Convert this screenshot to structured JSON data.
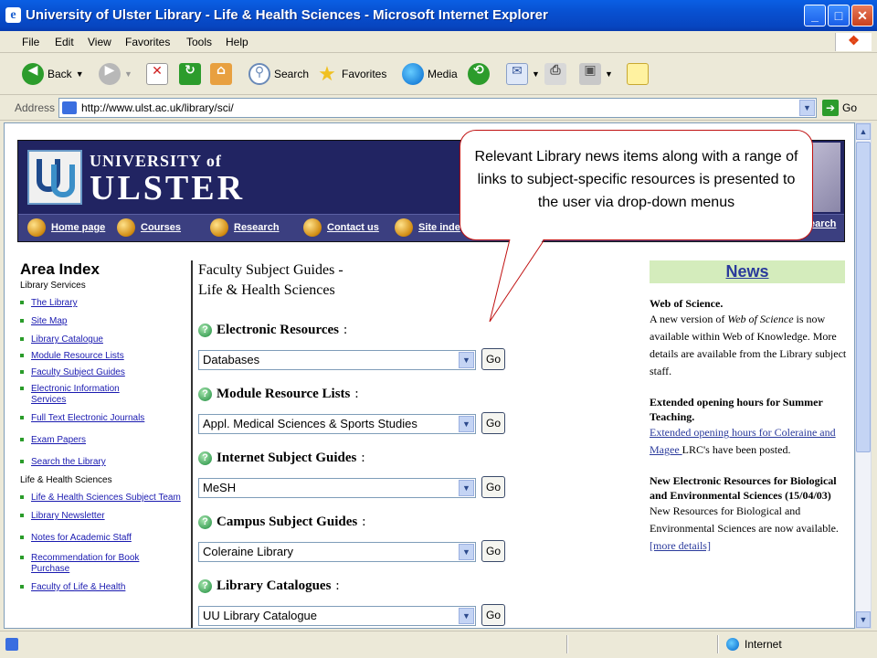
{
  "window": {
    "title": "University of Ulster Library - Life & Health Sciences - Microsoft Internet Explorer",
    "controls": {
      "minimize": "_",
      "maximize": "□",
      "close": "✕"
    }
  },
  "menu": [
    "File",
    "Edit",
    "View",
    "Favorites",
    "Tools",
    "Help"
  ],
  "toolbar": {
    "back": "Back",
    "search": "Search",
    "favorites": "Favorites",
    "media": "Media"
  },
  "address": {
    "label": "Address",
    "url": "http://www.ulst.ac.uk/library/sci/",
    "go": "Go"
  },
  "banner": {
    "logo_line1": "UNIVERSITY of",
    "logo_line2": "ULSTER",
    "nav": [
      "Home page",
      "Courses",
      "Research",
      "Contact us",
      "Site inde",
      "earch"
    ]
  },
  "left": {
    "title": "Area Index",
    "section1": "Library Services",
    "links1": [
      "The Library",
      "Site Map",
      "Library Catalogue",
      "Module Resource Lists",
      "Faculty Subject Guides",
      "Electronic Information Services",
      "Full Text Electronic Journals",
      "Exam Papers",
      "Search the Library"
    ],
    "section2": "Life & Health Sciences",
    "links2": [
      "Life & Health Sciences Subject Team",
      "Library Newsletter",
      "Notes for Academic Staff",
      "Recommendation for Book Purchase",
      "Faculty of Life & Health"
    ]
  },
  "middle": {
    "heading1": "Faculty Subject Guides -",
    "heading2": "Life & Health Sciences",
    "groups": [
      {
        "title": "Electronic Resources",
        "selected": "Databases"
      },
      {
        "title": "Module Resource Lists",
        "selected": "Appl. Medical Sciences & Sports Studies"
      },
      {
        "title": "Internet Subject Guides",
        "selected": "MeSH"
      },
      {
        "title": "Campus Subject Guides",
        "selected": "Coleraine Library"
      },
      {
        "title": "Library Catalogues",
        "selected": "UU Library Catalogue"
      }
    ],
    "go": "Go",
    "colon": ":"
  },
  "news": {
    "title": "News",
    "items": [
      {
        "title": "Web of Science.",
        "p1": "A new version of ",
        "em": "Web of Science",
        "p2": " is now available within Web of Knowledge. More details are available from the  Library subject staff."
      },
      {
        "title": "Extended opening hours for Summer Teaching.",
        "link": "Extended opening hours for Coleraine and Magee ",
        "tail": "LRC's have been posted."
      },
      {
        "title": "New Electronic Resources for Biological and Environmental Sciences    (15/04/03)",
        "body": "New Resources for Biological and Environmental Sciences are now available.",
        "more": "[more details]"
      }
    ]
  },
  "callout": {
    "text": "Relevant Library news items along with a range of links to subject-specific resources is presented to the user via drop-down menus"
  },
  "status": {
    "zone": "Internet"
  }
}
